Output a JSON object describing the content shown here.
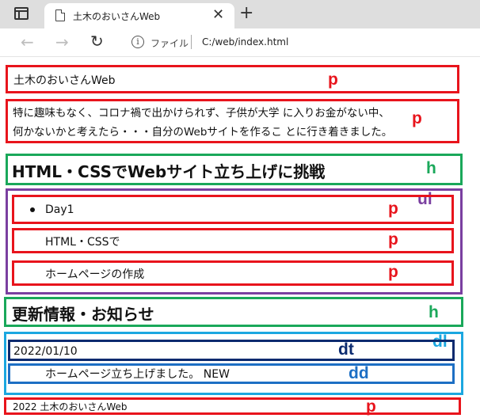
{
  "browser": {
    "tab_title": "土木のおいさんWeb",
    "new_tab_glyph": "+",
    "close_glyph": "✕",
    "origin_label": "ファイル",
    "address": "C:/web/index.html"
  },
  "page": {
    "site_title": "土木のおいさんWeb",
    "intro_line1": "特に趣味もなく、コロナ禍で出かけられず、子供が大学 に入りお金がない中、",
    "intro_line2": "何かないかと考えたら・・・自分のWebサイトを作るこ とに行き着きました。",
    "heading1": "HTML・CSSでWebサイト立ち上げに挑戦",
    "list_items": [
      "Day1",
      "HTML・CSSで",
      "ホームページの作成"
    ],
    "heading2": "更新情報・お知らせ",
    "dt": "2022/01/10",
    "dd": "ホームページ立ち上げました。 NEW",
    "footer": "2022 土木のおいさんWeb"
  },
  "annotations": {
    "p": "p",
    "h": "h",
    "ul": "ul",
    "dl": "dl",
    "dt": "dt",
    "dd": "dd"
  },
  "colors": {
    "p_box": "#e8141c",
    "h_box": "#1aa85a",
    "ul_box": "#7a3fa0",
    "dl_box": "#1ba7e0",
    "dt_box": "#0b2a6f",
    "dd_box": "#1d6fc4"
  },
  "icons": {
    "tab_actions": "tab-actions-icon",
    "page": "page-icon",
    "back": "arrow-left-icon",
    "forward": "arrow-right-icon",
    "reload": "reload-icon",
    "info": "info-icon"
  }
}
